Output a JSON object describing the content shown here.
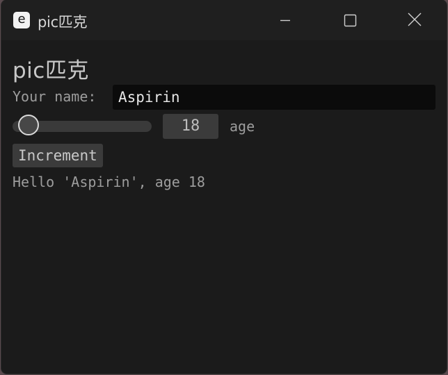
{
  "window": {
    "icon_letter": "e",
    "title": "pic匹克"
  },
  "main": {
    "heading": "pic匹克",
    "name_label": "Your name:",
    "name_value": "Aspirin",
    "age_slider": {
      "value": 18
    },
    "age_value": "18",
    "age_label": "age",
    "increment_label": "Increment",
    "greeting": "Hello 'Aspirin', age 18"
  },
  "colors": {
    "background": "#1b1b1b",
    "titlebar": "#1f1f1f",
    "input_bg": "#0b0b0b",
    "widget_bg": "#3b3b3b"
  }
}
